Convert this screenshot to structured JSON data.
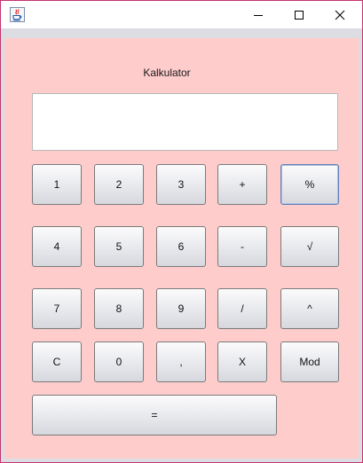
{
  "window": {
    "controls": {
      "minimize_icon": "minimize-icon",
      "maximize_icon": "maximize-icon",
      "close_icon": "close-icon"
    },
    "colors": {
      "border": "#c4346e",
      "content_bg": "#ffcccc",
      "frame": "#dcdde3"
    }
  },
  "app": {
    "title": "Kalkulator",
    "display_value": ""
  },
  "keys": {
    "k1": "1",
    "k2": "2",
    "k3": "3",
    "plus": "+",
    "percent": "%",
    "k4": "4",
    "k5": "5",
    "k6": "6",
    "minus": "-",
    "sqrt": "√",
    "k7": "7",
    "k8": "8",
    "k9": "9",
    "divide": "/",
    "power": "^",
    "clear": "C",
    "k0": "0",
    "comma": ",",
    "multiply": "X",
    "mod": "Mod",
    "equals": "="
  }
}
